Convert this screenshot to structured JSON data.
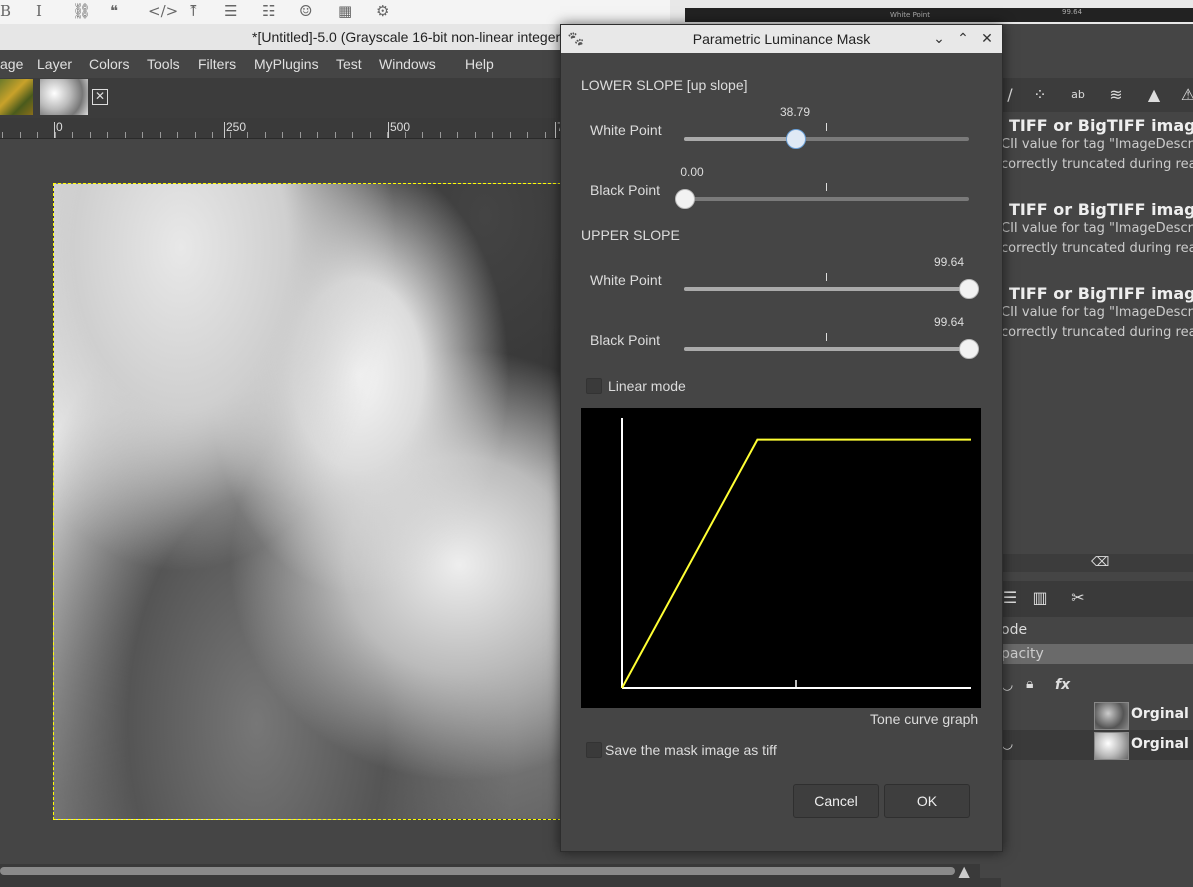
{
  "editor_toolbar": {
    "icons": [
      "bold-icon",
      "italic-icon",
      "link-icon",
      "quote-icon",
      "code-icon",
      "upload-icon",
      "bullet-list-icon",
      "numbered-list-icon",
      "emoji-icon",
      "calendar-icon",
      "gear-icon"
    ],
    "glyphs": [
      "B",
      "I",
      "⛓",
      "❝",
      "</>",
      "⤒",
      "☰",
      "☷",
      "☺",
      "▦",
      "⚙"
    ]
  },
  "right_strip": {
    "label1": "White Point",
    "label2": "99.64"
  },
  "window": {
    "title": "*[Untitled]-5.0 (Grayscale 16-bit non-linear integer,"
  },
  "menubar": [
    "age",
    "Layer",
    "Colors",
    "Tools",
    "Filters",
    "MyPlugins",
    "Test",
    "Windows",
    "Help"
  ],
  "ruler": {
    "labels": [
      "0",
      "250",
      "500",
      "7"
    ]
  },
  "dialog": {
    "title": "Parametric Luminance Mask",
    "lower_slope_label": "LOWER SLOPE [up slope]",
    "upper_slope_label": "UPPER SLOPE",
    "sliders": [
      {
        "label": "White Point",
        "value": "38.79",
        "fraction": 0.3879,
        "active": true
      },
      {
        "label": "Black Point",
        "value": "0.00",
        "fraction": 0.0,
        "active": false
      },
      {
        "label": "White Point",
        "value": "99.64",
        "fraction": 0.9964,
        "active": false
      },
      {
        "label": "Black Point",
        "value": "99.64",
        "fraction": 0.9964,
        "active": false
      }
    ],
    "linear_mode_label": "Linear mode",
    "linear_mode_checked": false,
    "graph_caption": "Tone curve graph",
    "save_mask_label": "Save the mask image as tiff",
    "save_mask_checked": false,
    "cancel_label": "Cancel",
    "ok_label": "OK",
    "curve": {
      "low_black": 0.0,
      "low_white": 0.3879,
      "high_white": 0.9964,
      "high_black": 0.9964,
      "plateau": 0.92
    }
  },
  "right_panel": {
    "messages": [
      {
        "heading": "TIFF or BigTIFF image W",
        "line1": "CII value for tag \"ImageDescrip",
        "line2": "correctly truncated during readi"
      },
      {
        "heading": "TIFF or BigTIFF image W",
        "line1": "CII value for tag \"ImageDescrip",
        "line2": "correctly truncated during readi"
      },
      {
        "heading": "TIFF or BigTIFF image W",
        "line1": "CII value for tag \"ImageDescrip",
        "line2": "correctly truncated during readi"
      }
    ],
    "mode_label": "ode",
    "opacity_label": "pacity",
    "fx_label": "fx",
    "layers": [
      {
        "name": "Orginal (F"
      },
      {
        "name": "Orginal (F"
      }
    ]
  }
}
